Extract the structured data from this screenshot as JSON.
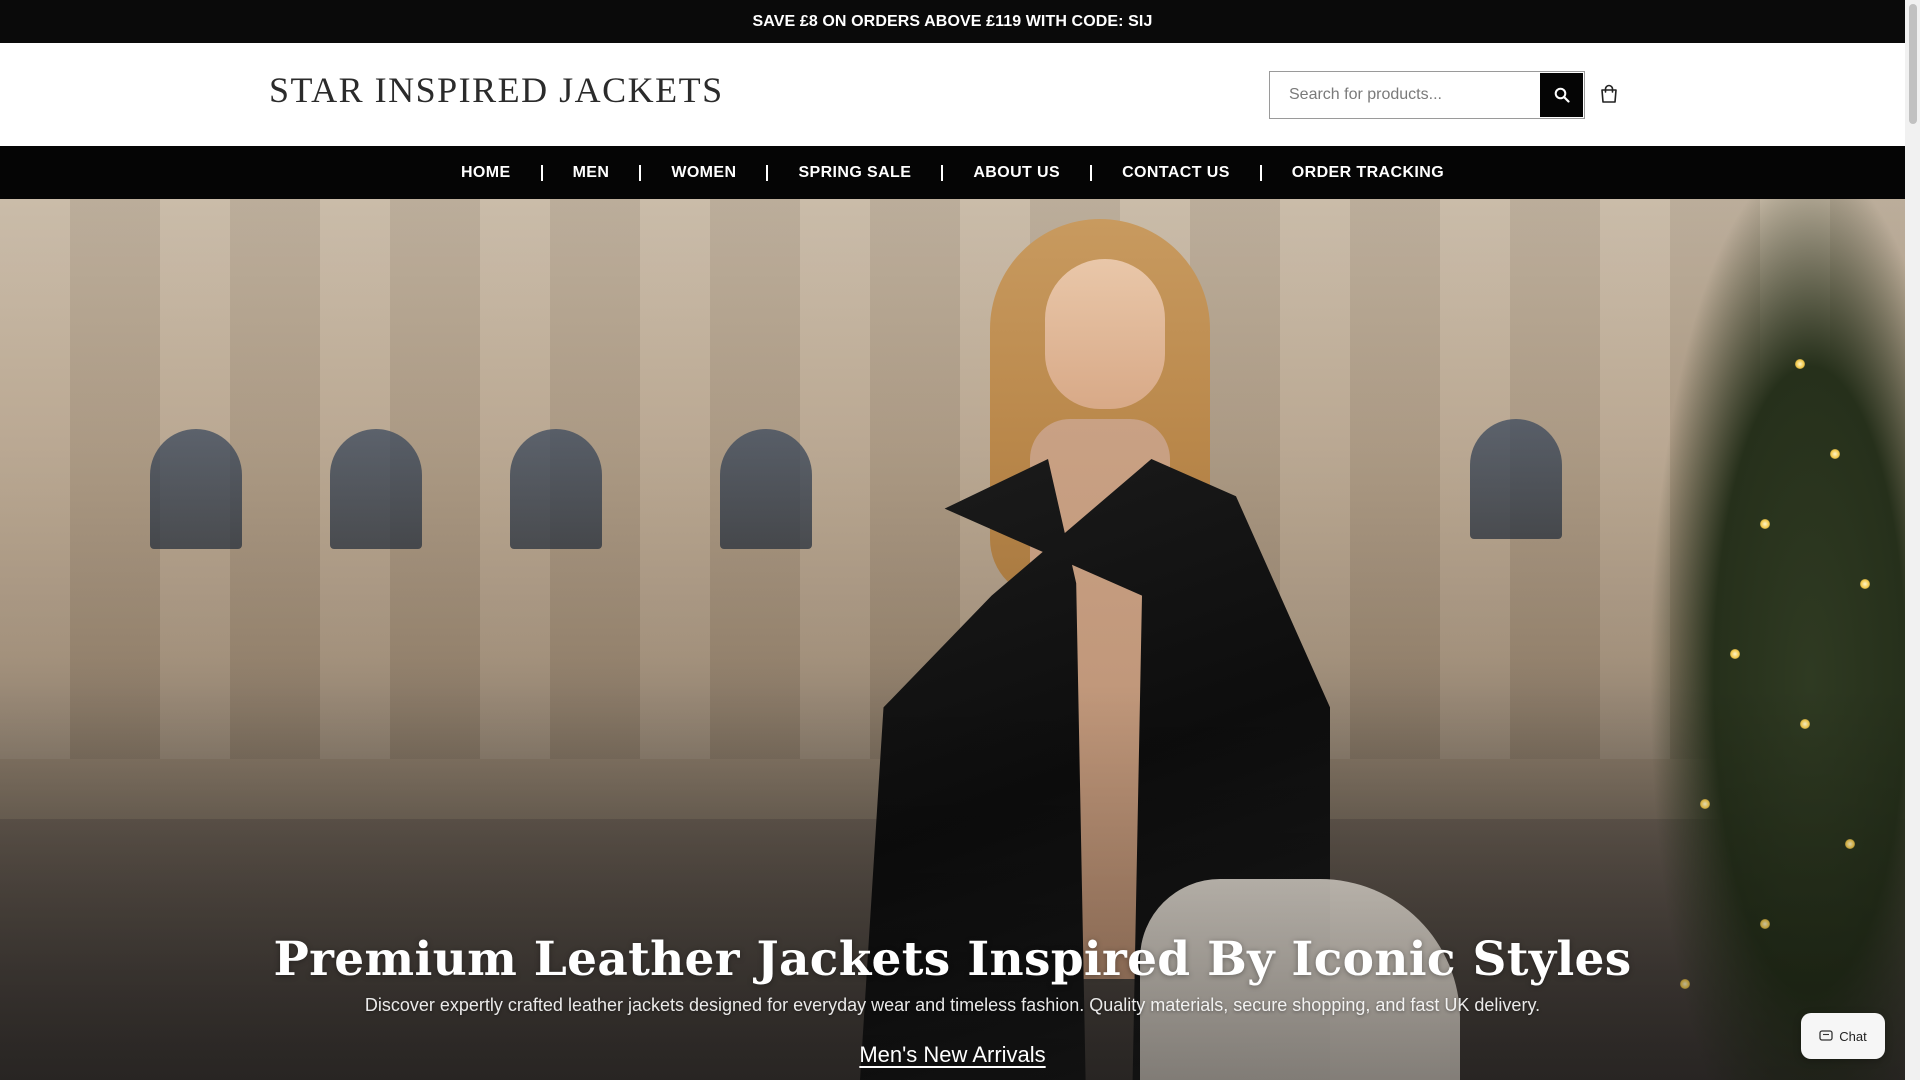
{
  "announcement": {
    "text": "SAVE £8 ON ORDERS ABOVE £119 WITH CODE: SIJ"
  },
  "header": {
    "logo": "STAR INSPIRED JACKETS",
    "search": {
      "placeholder": "Search for products..."
    }
  },
  "nav": {
    "items": [
      {
        "label": "HOME"
      },
      {
        "label": "MEN"
      },
      {
        "label": "WOMEN"
      },
      {
        "label": "SPRING SALE"
      },
      {
        "label": "ABOUT US"
      },
      {
        "label": "CONTACT US"
      },
      {
        "label": "ORDER TRACKING"
      }
    ]
  },
  "hero": {
    "title": "Premium Leather Jackets Inspired By Iconic Styles",
    "subtitle": "Discover expertly crafted leather jackets designed for everyday wear and timeless fashion. Quality materials, secure shopping, and fast UK delivery.",
    "cta": "Men's New Arrivals"
  },
  "chat": {
    "label": "Chat"
  },
  "colors": {
    "announcement_bg": "#0a0a0a",
    "nav_bg": "#050505",
    "search_button_bg": "#050505"
  },
  "icons": {
    "search": "search-icon",
    "cart": "cart-icon",
    "chat": "chat-icon"
  }
}
